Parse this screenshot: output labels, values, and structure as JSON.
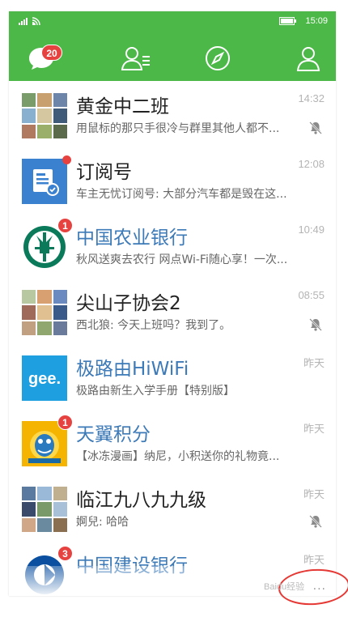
{
  "status_bar": {
    "time": "15:09"
  },
  "tabs": {
    "chats_badge": "20"
  },
  "chats": [
    {
      "name": "黄金中二班",
      "message": "用鼠标的那只手很冷与群里其他人都不...",
      "time": "14:32",
      "muted": true
    },
    {
      "name": "订阅号",
      "message": "车主无忧订阅号: 大部分汽车都是毁在这...",
      "time": "12:08",
      "muted": false
    },
    {
      "name": "中国农业银行",
      "message": "秋风送爽去农行 网点Wi-Fi随心享！一次...",
      "time": "10:49",
      "muted": false,
      "badge": "1"
    },
    {
      "name": "尖山子协会2",
      "message": "西北狼: 今天上班吗？我到了。",
      "time": "08:55",
      "muted": true
    },
    {
      "name": "极路由HiWiFi",
      "message": "极路由新生入学手册【特别版】",
      "time": "昨天",
      "muted": false,
      "avatar_text": "gee."
    },
    {
      "name": "天翼积分",
      "message": "【冰冻漫画】纳尼，小积送你的礼物竟...",
      "time": "昨天",
      "muted": false,
      "badge": "1"
    },
    {
      "name": "临江九八九九级",
      "message": "婀兒: 哈哈",
      "time": "昨天",
      "muted": true
    },
    {
      "name": "中国建设银行",
      "message": "",
      "time": "昨天",
      "muted": false,
      "badge": "3"
    }
  ],
  "more": "...",
  "watermark": "Baidu经验",
  "colors": {
    "accent": "#4cb848",
    "badge": "#e64340",
    "sub_name": "#3d7ab8"
  }
}
